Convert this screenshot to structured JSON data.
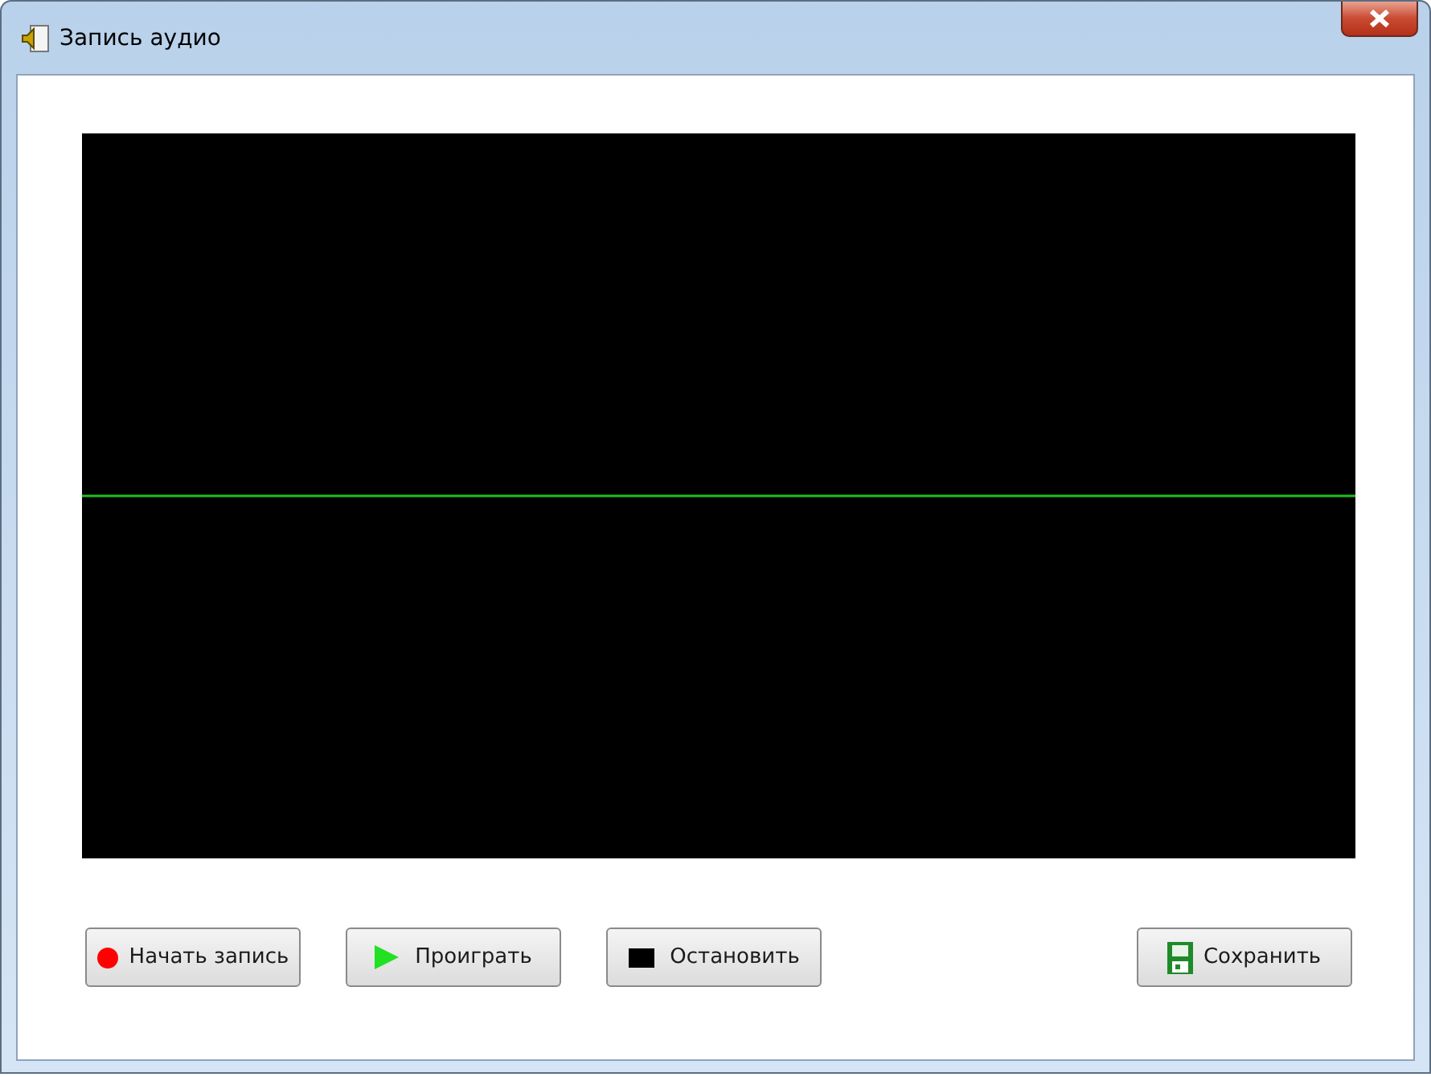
{
  "window": {
    "title": "Запись аудио"
  },
  "buttons": [
    {
      "label": "Начать запись",
      "kind": "record"
    },
    {
      "label": "Проиграть",
      "kind": "play"
    },
    {
      "label": "Остановить",
      "kind": "stop"
    },
    {
      "label": "Сохранить",
      "kind": "save"
    }
  ]
}
